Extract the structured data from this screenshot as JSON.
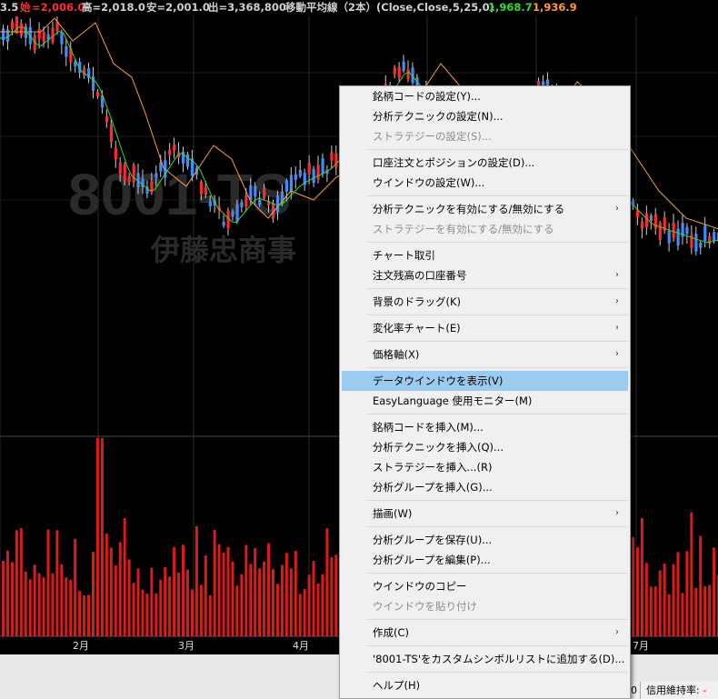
{
  "header": {
    "prev": "3.5",
    "open_label": "始",
    "open_value": "=2,006.0",
    "high": "高=2,018.0",
    "low": "安=2,001.0",
    "volume": "出=3,368,800",
    "ma_label": "移動平均線（2本）(Close,Close,5,25,0)",
    "ma_fast": "1,968.7",
    "ma_slow": "1,936.9",
    "colors": {
      "open": "#ff3030",
      "fast": "#33dd33",
      "slow": "#ff9a3c",
      "text": "#d0d0d0"
    }
  },
  "watermark": {
    "symbol": "8001-TS",
    "name": "伊藤忠商事"
  },
  "months": [
    "2月",
    "3月",
    "4月",
    "7月"
  ],
  "context_menu": {
    "items": [
      {
        "label": "銘柄コードの設定(Y)..."
      },
      {
        "label": "分析テクニックの設定(N)..."
      },
      {
        "label": "ストラテジーの設定(S)...",
        "disabled": true
      },
      {
        "sep": true
      },
      {
        "label": "口座注文とポジションの設定(D)..."
      },
      {
        "label": "ウインドウの設定(W)..."
      },
      {
        "sep": true
      },
      {
        "label": "分析テクニックを有効にする/無効にする",
        "submenu": true
      },
      {
        "label": "ストラテジーを有効にする/無効にする",
        "disabled": true
      },
      {
        "sep": true
      },
      {
        "label": "チャート取引"
      },
      {
        "label": "注文残高の口座番号",
        "submenu": true
      },
      {
        "sep": true
      },
      {
        "label": "背景のドラッグ(K)",
        "submenu": true
      },
      {
        "sep": true
      },
      {
        "label": "変化率チャート(E)",
        "submenu": true
      },
      {
        "sep": true
      },
      {
        "label": "価格軸(X)",
        "submenu": true
      },
      {
        "sep": true
      },
      {
        "label": "データウインドウを表示(V)",
        "highlight": true
      },
      {
        "label": "EasyLanguage 使用モニター(M)"
      },
      {
        "sep": true
      },
      {
        "label": "銘柄コードを挿入(M)..."
      },
      {
        "label": "分析テクニックを挿入(Q)..."
      },
      {
        "label": "ストラテジーを挿入...(R)"
      },
      {
        "label": "分析グループを挿入(G)..."
      },
      {
        "sep": true
      },
      {
        "label": "描画(W)",
        "submenu": true
      },
      {
        "sep": true
      },
      {
        "label": "分析グループを保存(U)..."
      },
      {
        "label": "分析グループを編集(P)..."
      },
      {
        "sep": true
      },
      {
        "label": "ウインドウのコピー"
      },
      {
        "label": "ウインドウを貼り付け",
        "disabled": true
      },
      {
        "sep": true
      },
      {
        "label": "作成(C)",
        "submenu": true
      },
      {
        "sep": true
      },
      {
        "label": "'8001-TS'をカスタムシンボルリストに追加する(D)..."
      },
      {
        "sep": true
      },
      {
        "label": "ヘルプ(H)"
      }
    ]
  },
  "status_bar": {
    "left_fragment": "0",
    "margin_label": "信用維持率:",
    "margin_value": "-"
  },
  "arrow_glyph": "›"
}
